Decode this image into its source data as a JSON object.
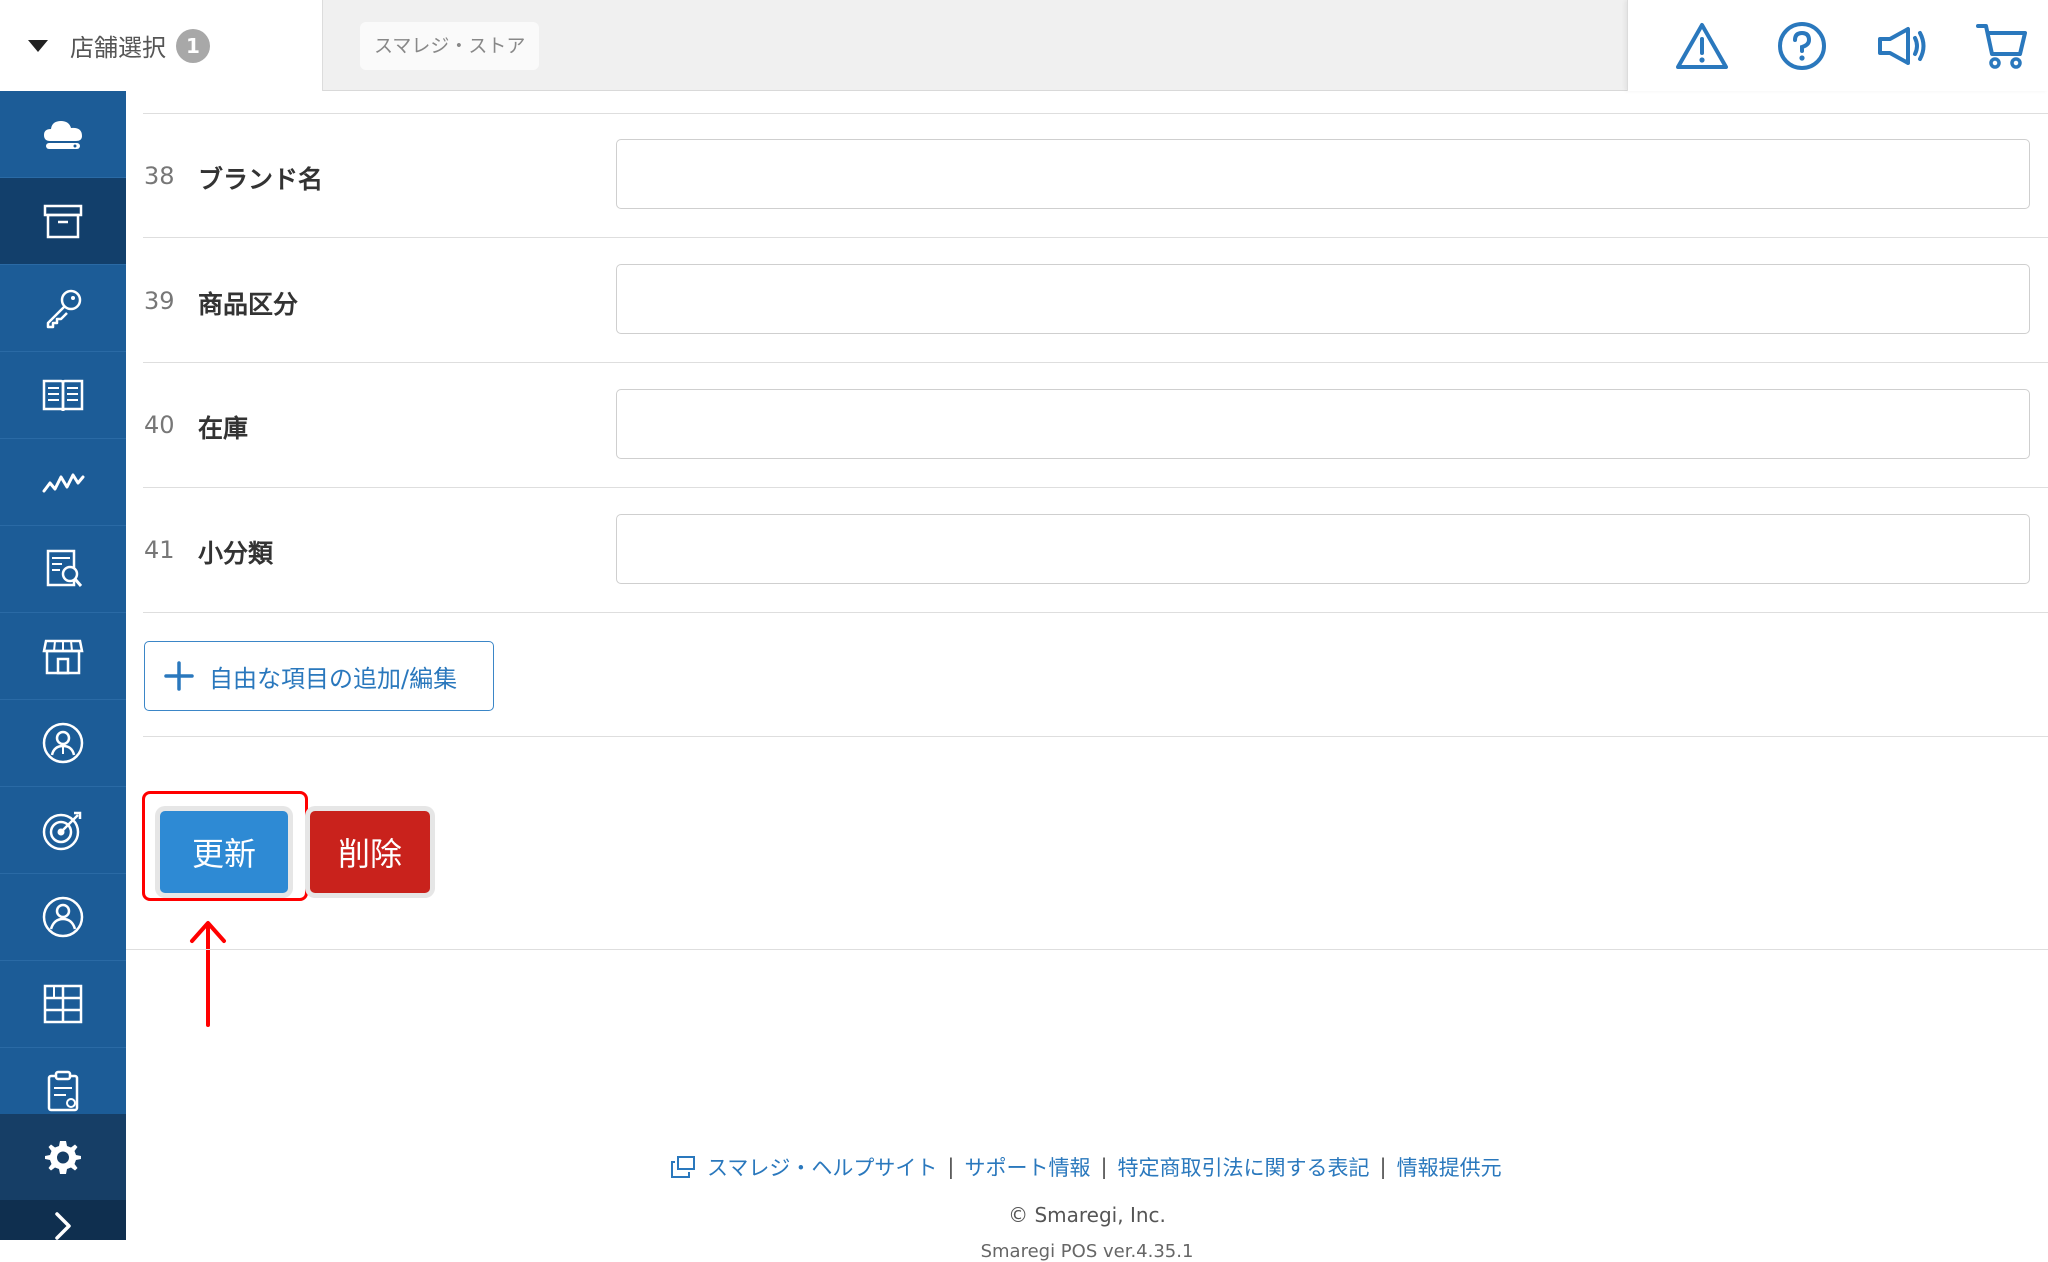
{
  "header": {
    "store_select_label": "店舗選択",
    "store_count": "1",
    "store_name": "スマレジ・ストア",
    "icons": [
      "alert-icon",
      "help-icon",
      "announcement-icon",
      "cart-icon"
    ]
  },
  "sidebar": {
    "items": [
      "cloud-icon",
      "archive-icon",
      "key-icon",
      "book-icon",
      "chart-icon",
      "report-icon",
      "store-icon",
      "staff-icon",
      "target-icon",
      "member-icon",
      "apps-icon",
      "clipboard-icon"
    ],
    "active_item": "archive-icon",
    "bottom": [
      "gear-icon",
      "expand-icon"
    ]
  },
  "form": {
    "rows": [
      {
        "num": "38",
        "label": "ブランド名",
        "value": ""
      },
      {
        "num": "39",
        "label": "商品区分",
        "value": ""
      },
      {
        "num": "40",
        "label": "在庫",
        "value": ""
      },
      {
        "num": "41",
        "label": "小分類",
        "value": ""
      }
    ],
    "add_button": "自由な項目の追加/編集",
    "update_button": "更新",
    "delete_button": "削除"
  },
  "footer": {
    "links": [
      "スマレジ・ヘルプサイト",
      "サポート情報",
      "特定商取引法に関する表記",
      "情報提供元"
    ],
    "separator": "|",
    "copyright": "© Smaregi, Inc.",
    "version": "Smaregi POS ver.4.35.1"
  },
  "colors": {
    "sidebar": "#1c5c97",
    "sidebar_active": "#123f6b",
    "primary": "#2e8ad4",
    "danger": "#c9221c",
    "link": "#2a78bd",
    "highlight": "#ff0000"
  }
}
